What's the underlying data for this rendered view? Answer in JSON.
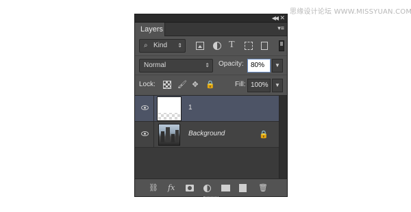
{
  "watermark": "思缘设计论坛 WWW.MISSYUAN.COM",
  "panel": {
    "tab_label": "Layers",
    "titlebar_icons": [
      "collapse-icon",
      "close-icon"
    ],
    "menu_icon": "panel-menu-icon"
  },
  "filter": {
    "kind_label": "Kind",
    "search_icon": "⌕",
    "type_glyph": "T",
    "icons": [
      "pixel-filter-icon",
      "adjustment-filter-icon",
      "type-filter-icon",
      "shape-filter-icon",
      "smart-object-filter-icon",
      "filter-toggle"
    ]
  },
  "blend": {
    "mode": "Normal",
    "opacity_label": "Opacity:",
    "opacity_value": "80%"
  },
  "lock": {
    "label": "Lock:",
    "fill_label": "Fill:",
    "fill_value": "100%",
    "icons": [
      "lock-transparent-icon",
      "lock-pixels-icon",
      "lock-position-icon",
      "lock-all-icon"
    ]
  },
  "layers": [
    {
      "name": "1",
      "visible": true,
      "selected": true,
      "locked": false
    },
    {
      "name": "Background",
      "visible": true,
      "selected": false,
      "locked": true
    }
  ],
  "bottom_bar": {
    "fx_label": "fx",
    "icons": [
      "link-layers-icon",
      "layer-style-icon",
      "layer-mask-icon",
      "adjustment-layer-icon",
      "new-group-icon",
      "new-layer-icon",
      "delete-layer-icon"
    ]
  },
  "colors": {
    "panel_bg": "#535353",
    "selected_row": "#4d5466",
    "opacity_focus": "#6a8fc8"
  }
}
